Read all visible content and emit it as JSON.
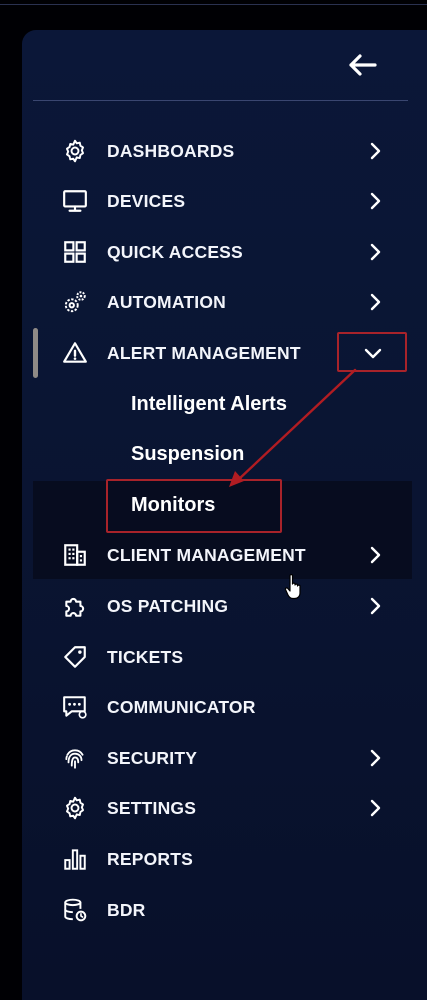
{
  "sidebar": {
    "items": [
      {
        "label": "DASHBOARDS",
        "icon": "gear-icon",
        "has_chevron": true
      },
      {
        "label": "DEVICES",
        "icon": "monitor-icon",
        "has_chevron": true
      },
      {
        "label": "QUICK ACCESS",
        "icon": "grid-icon",
        "has_chevron": true
      },
      {
        "label": "AUTOMATION",
        "icon": "gears-icon",
        "has_chevron": true
      },
      {
        "label": "ALERT MANAGEMENT",
        "icon": "warning-icon",
        "has_chevron": true,
        "expanded": true
      },
      {
        "label": "CLIENT MANAGEMENT",
        "icon": "building-icon",
        "has_chevron": true
      },
      {
        "label": "OS PATCHING",
        "icon": "puzzle-icon",
        "has_chevron": true
      },
      {
        "label": "TICKETS",
        "icon": "tag-icon",
        "has_chevron": false
      },
      {
        "label": "COMMUNICATOR",
        "icon": "chat-icon",
        "has_chevron": false
      },
      {
        "label": "SECURITY",
        "icon": "fingerprint-icon",
        "has_chevron": true
      },
      {
        "label": "SETTINGS",
        "icon": "gear-icon",
        "has_chevron": true
      },
      {
        "label": "REPORTS",
        "icon": "bar-chart-icon",
        "has_chevron": false
      },
      {
        "label": "BDR",
        "icon": "database-icon",
        "has_chevron": false
      }
    ],
    "alert_submenu": [
      "Intelligent Alerts",
      "Suspension",
      "Monitors"
    ]
  },
  "colors": {
    "panel": "#0a1533",
    "background": "#000004",
    "annotation": "#a8232a",
    "text": "#f3f5fb"
  }
}
